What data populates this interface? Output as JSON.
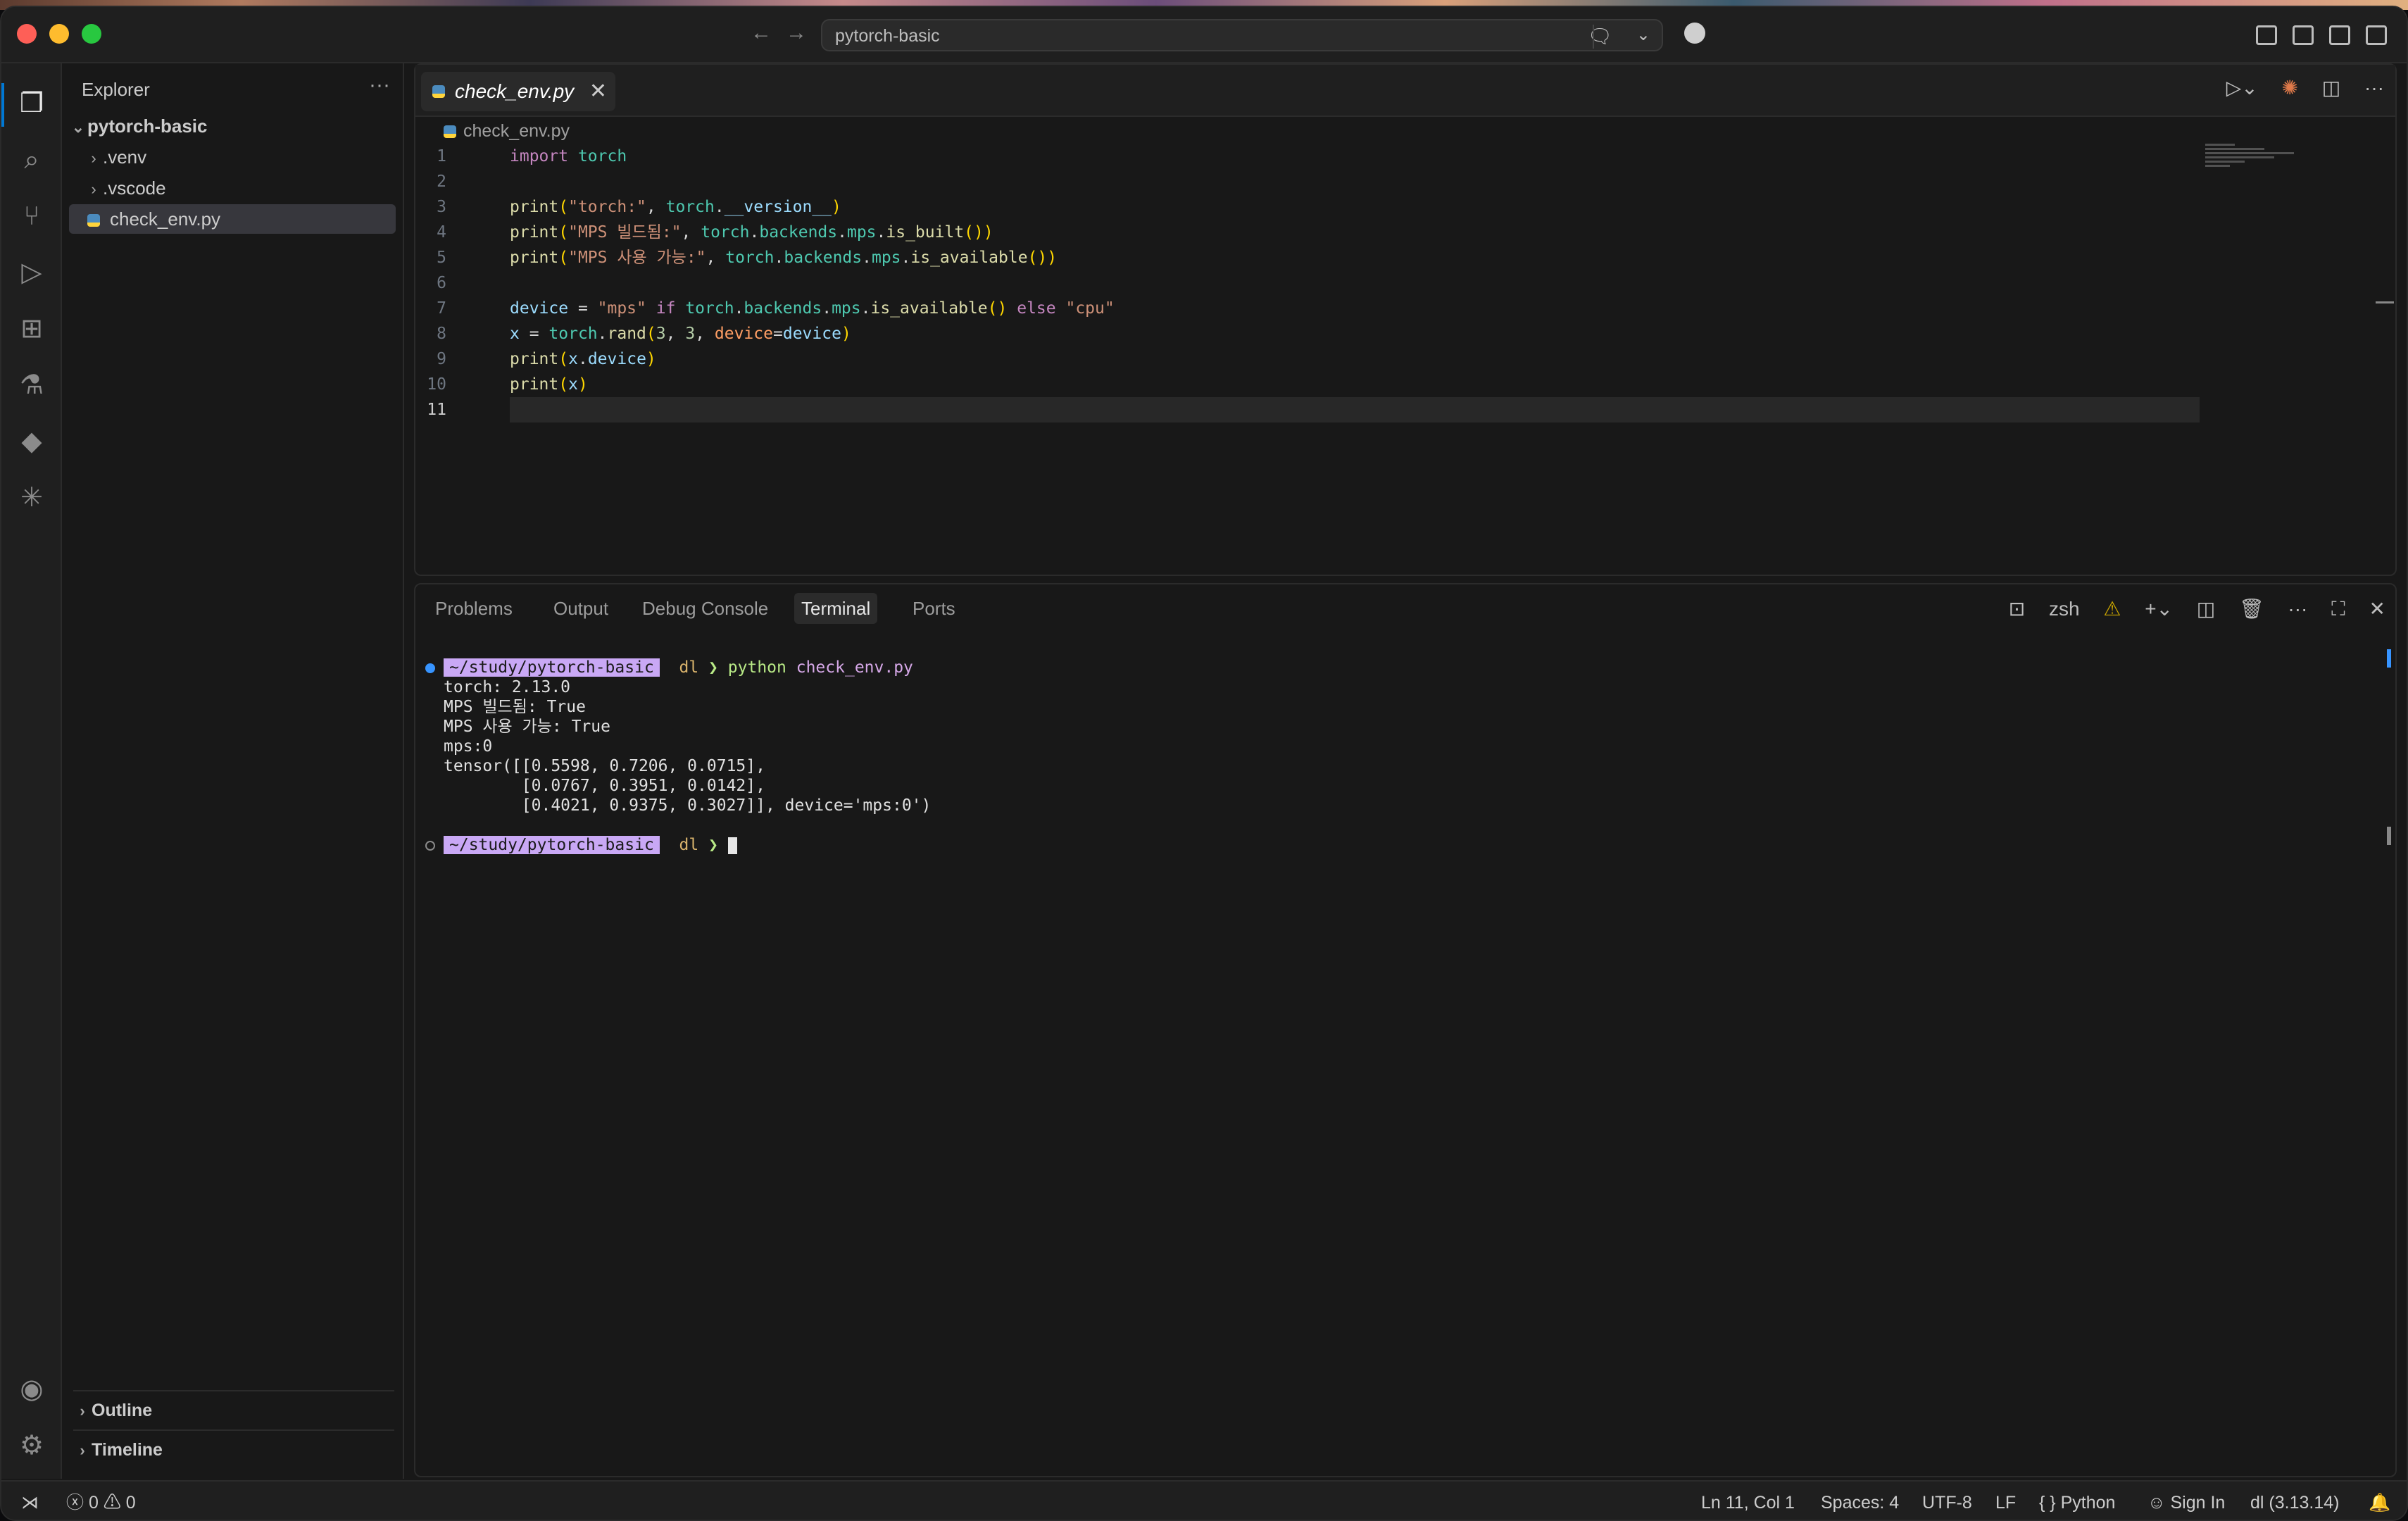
{
  "window": {
    "search_label": "pytorch-basic"
  },
  "sidebar": {
    "title": "Explorer",
    "more": "···",
    "root": "pytorch-basic",
    "items": [
      {
        "label": ".venv",
        "type": "folder"
      },
      {
        "label": ".vscode",
        "type": "folder"
      },
      {
        "label": "check_env.py",
        "type": "python-file"
      }
    ],
    "outline": "Outline",
    "timeline": "Timeline"
  },
  "editor": {
    "tab_label": "check_env.py",
    "breadcrumb": "check_env.py",
    "cursor_line": 11,
    "lines": [
      "import torch",
      "",
      "print(\"torch:\", torch.__version__)",
      "print(\"MPS 빌드됨:\", torch.backends.mps.is_built())",
      "print(\"MPS 사용 가능:\", torch.backends.mps.is_available())",
      "",
      "device = \"mps\" if torch.backends.mps.is_available() else \"cpu\"",
      "x = torch.rand(3, 3, device=device)",
      "print(x.device)",
      "print(x)",
      ""
    ]
  },
  "panel": {
    "tabs": [
      "Problems",
      "Output",
      "Debug Console",
      "Terminal",
      "Ports"
    ],
    "active_tab": "Terminal",
    "shell_label": "zsh",
    "terminal": {
      "prompt_path": "~/study/pytorch-basic",
      "prompt_env": "dl",
      "prompt_arrow": "❯",
      "command": "python",
      "command_args": "check_env.py",
      "output": [
        "torch: 2.13.0",
        "MPS 빌드됨: True",
        "MPS 사용 가능: True",
        "mps:0",
        "tensor([[0.5598, 0.7206, 0.0715],",
        "        [0.0767, 0.3951, 0.0142],",
        "        [0.4021, 0.9375, 0.3027]], device='mps:0')"
      ]
    }
  },
  "statusbar": {
    "errors": "0",
    "warnings": "0",
    "position": "Ln 11, Col 1",
    "spaces": "Spaces: 4",
    "encoding": "UTF-8",
    "eol": "LF",
    "language": "Python",
    "signin": "Sign In",
    "interpreter": "dl (3.13.14)"
  },
  "colors": {
    "accent": "#0078d4",
    "prompt_bg": "#c9a8f5",
    "warning": "#cca700"
  }
}
